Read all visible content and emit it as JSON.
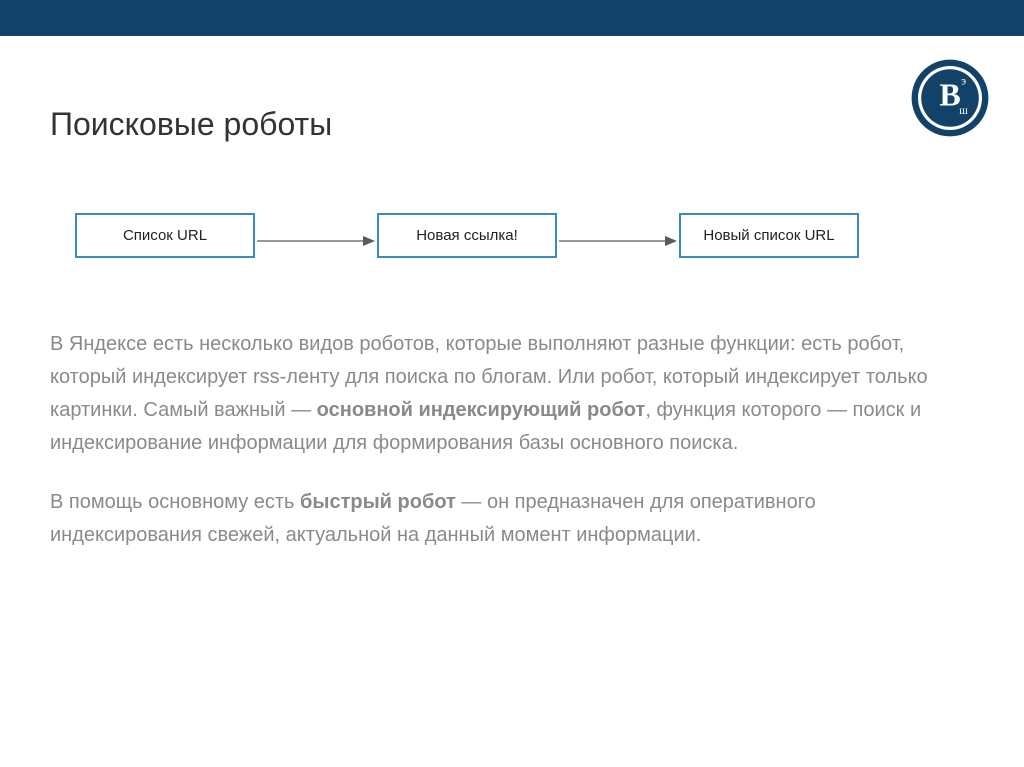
{
  "colors": {
    "header_bg": "#134269",
    "box_border": "#3b8ac3",
    "title_color": "#333333",
    "body_color": "#8a8a8a"
  },
  "title": "Поисковые роботы",
  "diagram": {
    "box1": "Список URL",
    "box2": "Новая ссылка!",
    "box3": "Новый список URL"
  },
  "paragraph1": {
    "t1": "В Яндексе есть несколько видов роботов, которые выполняют разные функции: есть робот, который индексирует rss-ленту для поиска по блогам. Или робот, который индексирует только картинки. Самый важный — ",
    "bold1": "основной индексирующий робот",
    "t2": ", функция которого — поиск и индексирование информации для формирования базы основного поиска."
  },
  "paragraph2": {
    "t1": "В помощь основному есть ",
    "bold1": "быстрый робот",
    "t2": " — он предназначен для оперативного индексирования свежей, актуальной на данный момент информации."
  }
}
